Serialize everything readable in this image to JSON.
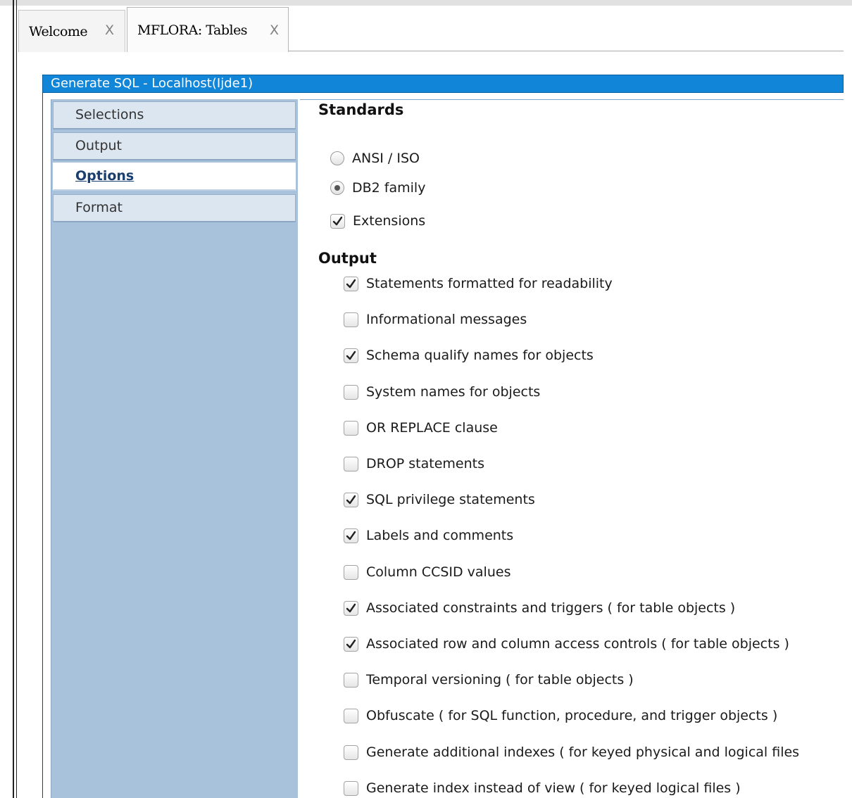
{
  "tabs": [
    {
      "label": "Welcome",
      "close": "X"
    },
    {
      "label": "MFLORA: Tables",
      "close": "X"
    }
  ],
  "dialog": {
    "title": "Generate SQL - Localhost(Ijde1)"
  },
  "sidebar": {
    "items": [
      {
        "label": "Selections",
        "active": false
      },
      {
        "label": "Output",
        "active": false
      },
      {
        "label": "Options",
        "active": true
      },
      {
        "label": "Format",
        "active": false
      }
    ]
  },
  "standards": {
    "title": "Standards",
    "radios": [
      {
        "label": "ANSI / ISO",
        "selected": false
      },
      {
        "label": "DB2 family",
        "selected": true
      }
    ],
    "extensions": {
      "label": "Extensions",
      "checked": true
    }
  },
  "output": {
    "title": "Output",
    "options": [
      {
        "label": "Statements formatted for readability",
        "checked": true
      },
      {
        "label": "Informational messages",
        "checked": false
      },
      {
        "label": "Schema qualify names for objects",
        "checked": true
      },
      {
        "label": "System names for objects",
        "checked": false
      },
      {
        "label": "OR REPLACE clause",
        "checked": false
      },
      {
        "label": "DROP statements",
        "checked": false
      },
      {
        "label": "SQL privilege statements",
        "checked": true
      },
      {
        "label": "Labels and comments",
        "checked": true
      },
      {
        "label": "Column CCSID values",
        "checked": false
      },
      {
        "label": "Associated constraints and triggers ( for table objects )",
        "checked": true
      },
      {
        "label": "Associated row and column access controls ( for table objects )",
        "checked": true
      },
      {
        "label": "Temporal versioning ( for table objects )",
        "checked": false
      },
      {
        "label": "Obfuscate ( for SQL function, procedure, and trigger objects )",
        "checked": false
      },
      {
        "label": "Generate additional indexes ( for keyed physical and logical files",
        "checked": false
      },
      {
        "label": "Generate index instead of view ( for keyed logical files )",
        "checked": false
      }
    ]
  },
  "colors": {
    "title_bar": "#1185d7",
    "sidebar": "#a9c2dc",
    "nav_item": "#dce6f1"
  }
}
